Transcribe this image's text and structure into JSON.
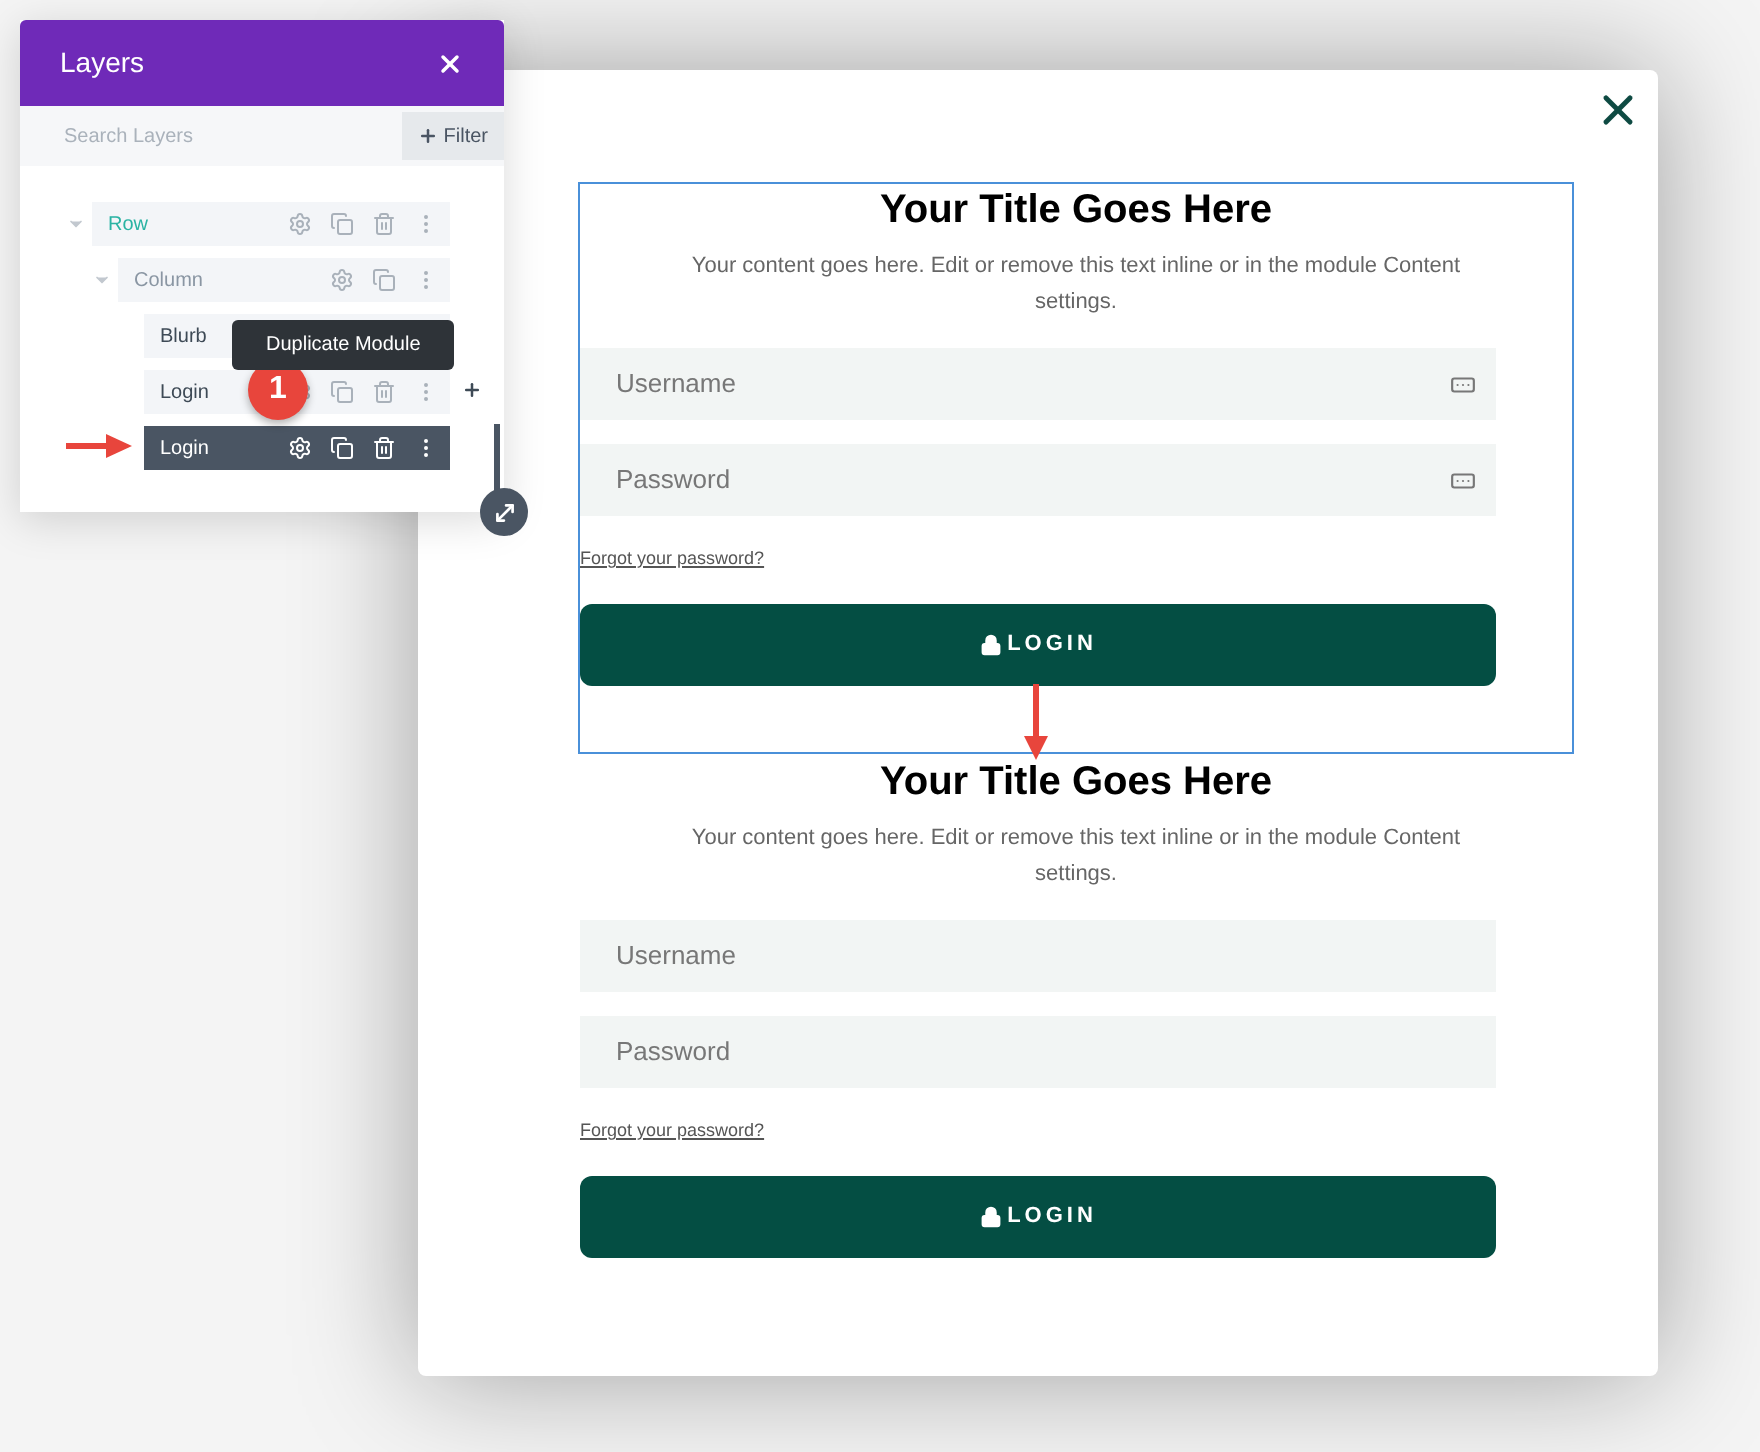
{
  "layers_panel": {
    "title": "Layers",
    "search": {
      "placeholder": "Search Layers"
    },
    "filter_button": "Filter",
    "tree": [
      {
        "kind": "row",
        "label": "Row",
        "expanded": true,
        "selected": false,
        "children": [
          {
            "kind": "column",
            "label": "Column",
            "expanded": true,
            "selected": false,
            "children": [
              {
                "kind": "module",
                "label": "Blurb",
                "selected": false,
                "tooltip": "Duplicate Module"
              },
              {
                "kind": "module",
                "label": "Login",
                "selected": false
              },
              {
                "kind": "module",
                "label": "Login",
                "selected": true
              }
            ]
          }
        ]
      }
    ],
    "step_badge": "1"
  },
  "modules": [
    {
      "title": "Your Title Goes Here",
      "body": "Your content goes here. Edit or remove this text inline or in the module Content settings.",
      "fields": [
        {
          "placeholder": "Username"
        },
        {
          "placeholder": "Password"
        }
      ],
      "autofill_icon": true,
      "forgot_link": "Forgot your password?",
      "button": "LOGIN",
      "selected": true
    },
    {
      "title": "Your Title Goes Here",
      "body": "Your content goes here. Edit or remove this text inline or in the module Content settings.",
      "fields": [
        {
          "placeholder": "Username"
        },
        {
          "placeholder": "Password"
        }
      ],
      "autofill_icon": false,
      "forgot_link": "Forgot your password?",
      "button": "LOGIN",
      "selected": false
    }
  ]
}
